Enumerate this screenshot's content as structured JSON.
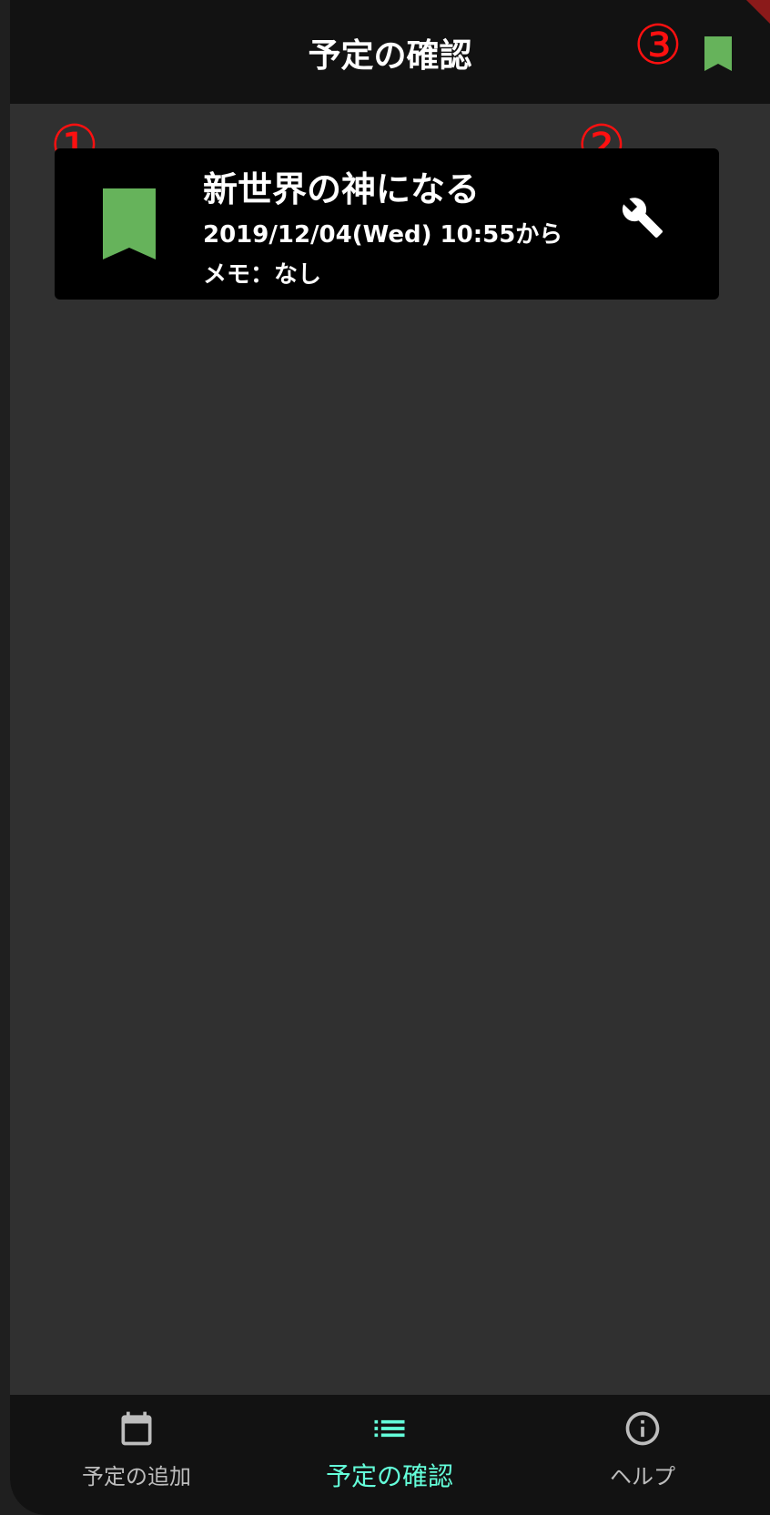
{
  "app_bar": {
    "title": "予定の確認",
    "action_icon": "bookmark-icon"
  },
  "annotations": {
    "one": "①",
    "two": "②",
    "three": "③"
  },
  "schedule": {
    "items": [
      {
        "title": "新世界の神になる",
        "datetime": "2019/12/04(Wed) 10:55から",
        "memo": "メモ：なし",
        "leading_icon": "bookmark-icon",
        "trailing_icon": "wrench-icon"
      }
    ]
  },
  "bottom_nav": {
    "items": [
      {
        "label": "予定の追加",
        "icon": "calendar-icon",
        "active": false
      },
      {
        "label": "予定の確認",
        "icon": "list-icon",
        "active": true
      },
      {
        "label": "ヘルプ",
        "icon": "info-icon",
        "active": false
      }
    ]
  },
  "colors": {
    "background": "#303030",
    "app_bar": "#121212",
    "card": "#000000",
    "bookmark_green": "#66b35b",
    "active_nav": "#64ffda",
    "inactive_nav": "#bdbdbd",
    "annotation_red": "#ff1010"
  }
}
